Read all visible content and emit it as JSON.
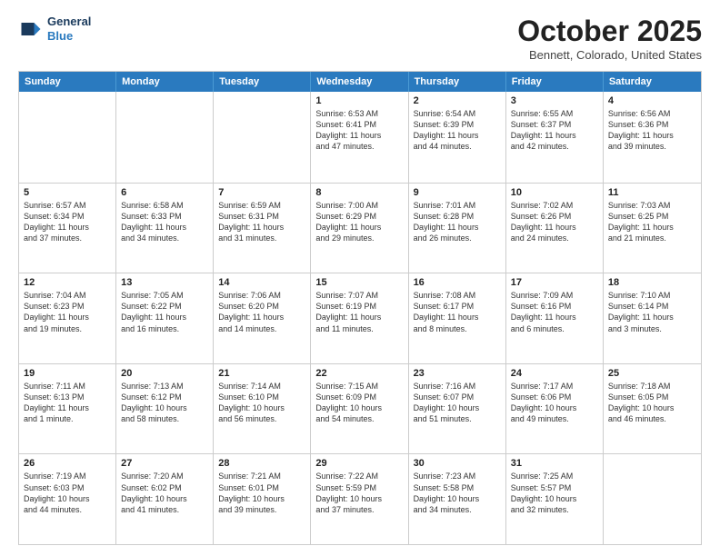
{
  "header": {
    "logo_line1": "General",
    "logo_line2": "Blue",
    "month": "October 2025",
    "location": "Bennett, Colorado, United States"
  },
  "days_of_week": [
    "Sunday",
    "Monday",
    "Tuesday",
    "Wednesday",
    "Thursday",
    "Friday",
    "Saturday"
  ],
  "weeks": [
    [
      {
        "day": "",
        "text": ""
      },
      {
        "day": "",
        "text": ""
      },
      {
        "day": "",
        "text": ""
      },
      {
        "day": "1",
        "text": "Sunrise: 6:53 AM\nSunset: 6:41 PM\nDaylight: 11 hours\nand 47 minutes."
      },
      {
        "day": "2",
        "text": "Sunrise: 6:54 AM\nSunset: 6:39 PM\nDaylight: 11 hours\nand 44 minutes."
      },
      {
        "day": "3",
        "text": "Sunrise: 6:55 AM\nSunset: 6:37 PM\nDaylight: 11 hours\nand 42 minutes."
      },
      {
        "day": "4",
        "text": "Sunrise: 6:56 AM\nSunset: 6:36 PM\nDaylight: 11 hours\nand 39 minutes."
      }
    ],
    [
      {
        "day": "5",
        "text": "Sunrise: 6:57 AM\nSunset: 6:34 PM\nDaylight: 11 hours\nand 37 minutes."
      },
      {
        "day": "6",
        "text": "Sunrise: 6:58 AM\nSunset: 6:33 PM\nDaylight: 11 hours\nand 34 minutes."
      },
      {
        "day": "7",
        "text": "Sunrise: 6:59 AM\nSunset: 6:31 PM\nDaylight: 11 hours\nand 31 minutes."
      },
      {
        "day": "8",
        "text": "Sunrise: 7:00 AM\nSunset: 6:29 PM\nDaylight: 11 hours\nand 29 minutes."
      },
      {
        "day": "9",
        "text": "Sunrise: 7:01 AM\nSunset: 6:28 PM\nDaylight: 11 hours\nand 26 minutes."
      },
      {
        "day": "10",
        "text": "Sunrise: 7:02 AM\nSunset: 6:26 PM\nDaylight: 11 hours\nand 24 minutes."
      },
      {
        "day": "11",
        "text": "Sunrise: 7:03 AM\nSunset: 6:25 PM\nDaylight: 11 hours\nand 21 minutes."
      }
    ],
    [
      {
        "day": "12",
        "text": "Sunrise: 7:04 AM\nSunset: 6:23 PM\nDaylight: 11 hours\nand 19 minutes."
      },
      {
        "day": "13",
        "text": "Sunrise: 7:05 AM\nSunset: 6:22 PM\nDaylight: 11 hours\nand 16 minutes."
      },
      {
        "day": "14",
        "text": "Sunrise: 7:06 AM\nSunset: 6:20 PM\nDaylight: 11 hours\nand 14 minutes."
      },
      {
        "day": "15",
        "text": "Sunrise: 7:07 AM\nSunset: 6:19 PM\nDaylight: 11 hours\nand 11 minutes."
      },
      {
        "day": "16",
        "text": "Sunrise: 7:08 AM\nSunset: 6:17 PM\nDaylight: 11 hours\nand 8 minutes."
      },
      {
        "day": "17",
        "text": "Sunrise: 7:09 AM\nSunset: 6:16 PM\nDaylight: 11 hours\nand 6 minutes."
      },
      {
        "day": "18",
        "text": "Sunrise: 7:10 AM\nSunset: 6:14 PM\nDaylight: 11 hours\nand 3 minutes."
      }
    ],
    [
      {
        "day": "19",
        "text": "Sunrise: 7:11 AM\nSunset: 6:13 PM\nDaylight: 11 hours\nand 1 minute."
      },
      {
        "day": "20",
        "text": "Sunrise: 7:13 AM\nSunset: 6:12 PM\nDaylight: 10 hours\nand 58 minutes."
      },
      {
        "day": "21",
        "text": "Sunrise: 7:14 AM\nSunset: 6:10 PM\nDaylight: 10 hours\nand 56 minutes."
      },
      {
        "day": "22",
        "text": "Sunrise: 7:15 AM\nSunset: 6:09 PM\nDaylight: 10 hours\nand 54 minutes."
      },
      {
        "day": "23",
        "text": "Sunrise: 7:16 AM\nSunset: 6:07 PM\nDaylight: 10 hours\nand 51 minutes."
      },
      {
        "day": "24",
        "text": "Sunrise: 7:17 AM\nSunset: 6:06 PM\nDaylight: 10 hours\nand 49 minutes."
      },
      {
        "day": "25",
        "text": "Sunrise: 7:18 AM\nSunset: 6:05 PM\nDaylight: 10 hours\nand 46 minutes."
      }
    ],
    [
      {
        "day": "26",
        "text": "Sunrise: 7:19 AM\nSunset: 6:03 PM\nDaylight: 10 hours\nand 44 minutes."
      },
      {
        "day": "27",
        "text": "Sunrise: 7:20 AM\nSunset: 6:02 PM\nDaylight: 10 hours\nand 41 minutes."
      },
      {
        "day": "28",
        "text": "Sunrise: 7:21 AM\nSunset: 6:01 PM\nDaylight: 10 hours\nand 39 minutes."
      },
      {
        "day": "29",
        "text": "Sunrise: 7:22 AM\nSunset: 5:59 PM\nDaylight: 10 hours\nand 37 minutes."
      },
      {
        "day": "30",
        "text": "Sunrise: 7:23 AM\nSunset: 5:58 PM\nDaylight: 10 hours\nand 34 minutes."
      },
      {
        "day": "31",
        "text": "Sunrise: 7:25 AM\nSunset: 5:57 PM\nDaylight: 10 hours\nand 32 minutes."
      },
      {
        "day": "",
        "text": ""
      }
    ]
  ]
}
